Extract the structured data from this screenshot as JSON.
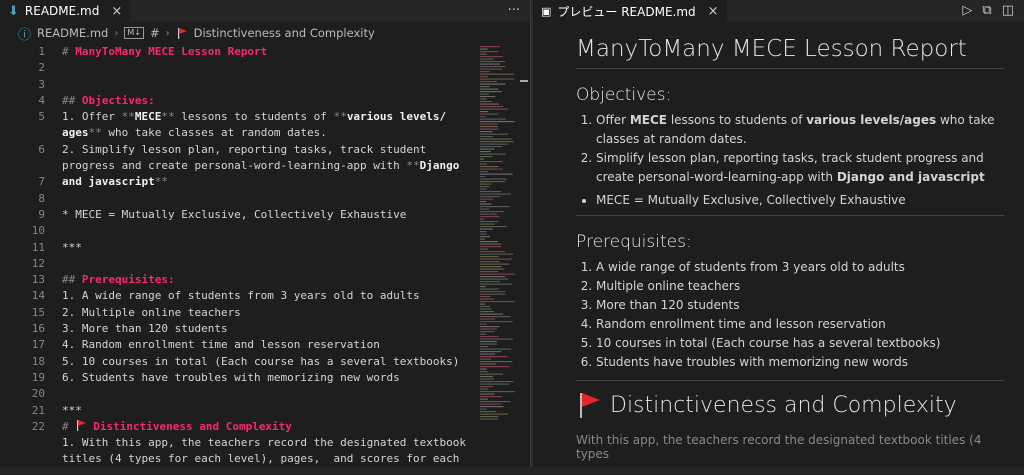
{
  "left": {
    "tab_label": "README.md",
    "breadcrumb": {
      "file": "README.md",
      "hash": "#",
      "section": "Distinctiveness and Complexity"
    },
    "more_label": "···"
  },
  "right": {
    "tab_label": "プレビュー README.md"
  },
  "line_numbers": [
    "1",
    "2",
    "3",
    "4",
    "5",
    "",
    "6",
    "",
    "7",
    "8",
    "9",
    "10",
    "11",
    "12",
    "13",
    "14",
    "15",
    "16",
    "17",
    "18",
    "19",
    "20",
    "21",
    "22",
    ""
  ],
  "code": {
    "l1_mark": "# ",
    "l1_text": "ManyToMany MECE Lesson Report",
    "l4_mark": "## ",
    "l4_text": "Objectives:",
    "l5_a": "1. Offer ",
    "l5_m1": "**",
    "l5_b1": "MECE",
    "l5_m2": "**",
    "l5_c": " lessons to students of ",
    "l5_m3": "**",
    "l5_b2": "various levels/",
    "l5w_b": "ages",
    "l5w_m": "**",
    "l5w_c": " who take classes at random dates.",
    "l6_a": "2. Simplify lesson plan, reporting tasks, track student",
    "l6w_a": "progress and create personal-word-learning-app with ",
    "l6w_m": "**",
    "l6w_b": "Django",
    "l6w2_b": "and javascript",
    "l6w2_m": "**",
    "l8": "* MECE = Mutually Exclusive, Collectively Exhaustive",
    "l10": "***",
    "l12_mark": "## ",
    "l12_text": "Prerequisites:",
    "l13": "1. A wide range of students from 3 years old to adults",
    "l14": "2. Multiple online teachers",
    "l15": "3. More than 120 students",
    "l16": "4. Random enrollment time and lesson reservation",
    "l17": "5. 10 courses in total (Each course has a several textbooks)",
    "l18": "6. Students have troubles with memorizing new words",
    "l20": "***",
    "l21_mark": "# ",
    "l21_text": "Distinctiveness and Complexity",
    "l22": "1. With this app, the teachers record the designated textbook",
    "l22w": "titles (4 types for each level), pages,  and scores for each"
  },
  "preview": {
    "title": "ManyToMany MECE Lesson Report",
    "objectives_heading": "Objectives:",
    "obj1_a": "Offer ",
    "obj1_b": "MECE",
    "obj1_c": " lessons to students of ",
    "obj1_d": "various levels/ages",
    "obj1_e": " who take classes at random dates.",
    "obj2_a": "Simplify lesson plan, reporting tasks, track student progress and create personal-word-learning-app with ",
    "obj2_b": "Django and javascript",
    "mece": "MECE = Mutually Exclusive, Collectively Exhaustive",
    "prereq_heading": "Prerequisites:",
    "prereqs": [
      "A wide range of students from 3 years old to adults",
      "Multiple online teachers",
      "More than 120 students",
      "Random enrollment time and lesson reservation",
      "10 courses in total (Each course has a several textbooks)",
      "Students have troubles with memorizing new words"
    ],
    "distinct_heading": "Distinctiveness and Complexity",
    "faded": "With this app, the teachers record the designated textbook titles (4 types"
  },
  "colors": {
    "heading": "#f92672",
    "accent": "#519aba",
    "flag": "#e0282e"
  }
}
